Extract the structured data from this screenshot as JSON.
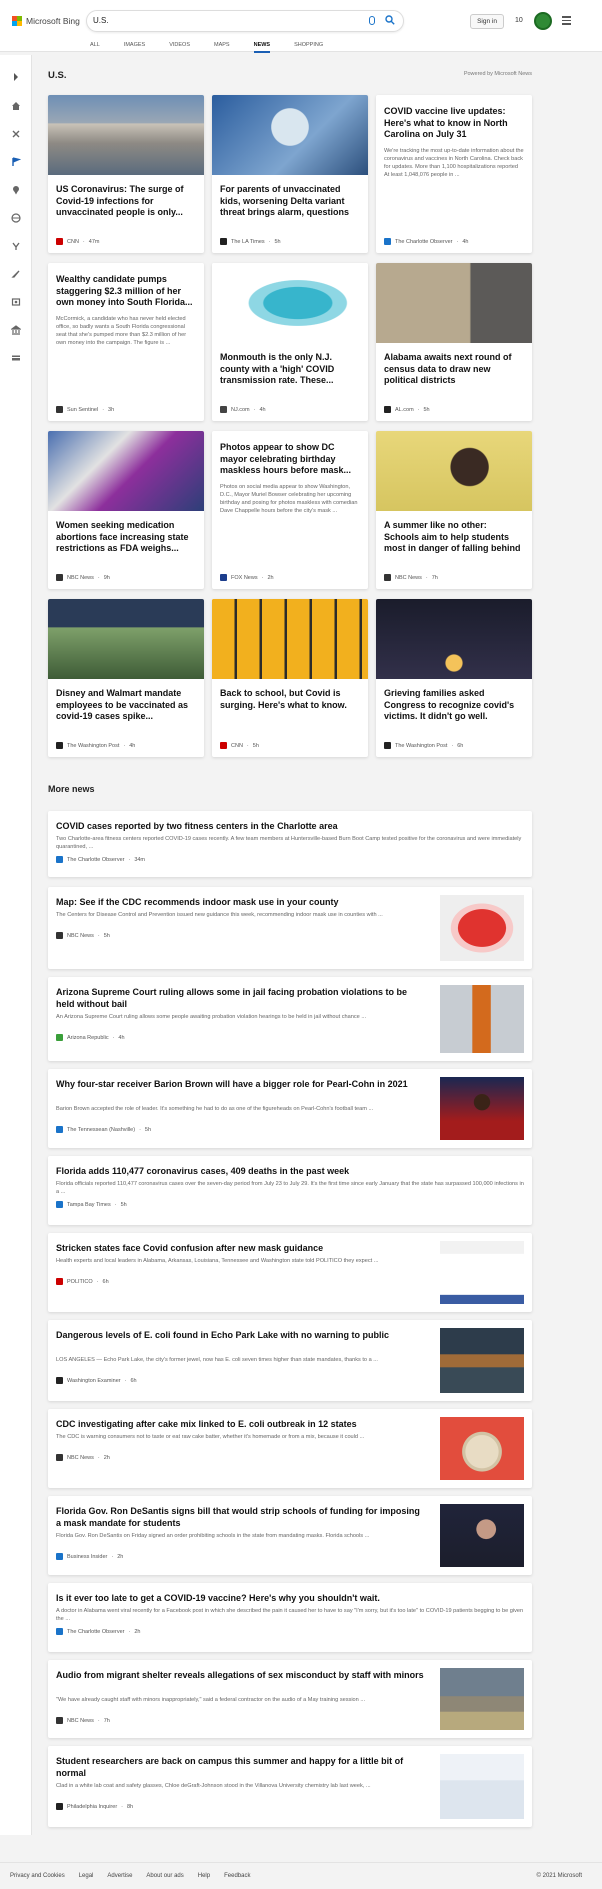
{
  "brand": {
    "name": "Microsoft Bing"
  },
  "search": {
    "query": "U.S."
  },
  "header": {
    "sign_in": "Sign in",
    "rewards_count": "10"
  },
  "tabs": [
    {
      "label": "ALL"
    },
    {
      "label": "IMAGES"
    },
    {
      "label": "VIDEOS"
    },
    {
      "label": "MAPS"
    },
    {
      "label": "NEWS",
      "active": true
    },
    {
      "label": "SHOPPING"
    }
  ],
  "rail_icons": [
    "chevron-right-icon",
    "home-icon",
    "science-icon",
    "flag-icon",
    "location-icon",
    "globe-icon",
    "scales-icon",
    "rocket-icon",
    "film-icon",
    "bank-icon",
    "card-icon"
  ],
  "section": {
    "title": "U.S.",
    "powered_by": "Powered by Microsoft News"
  },
  "cards": [
    {
      "title": "US Coronavirus: The surge of Covid-19 infections for unvaccinated people is only...",
      "source": "CNN",
      "time": "47m",
      "favicon_color": "#cc0000",
      "image": "tents"
    },
    {
      "title": "For parents of unvaccinated kids, worsening Delta variant threat brings alarm, questions",
      "source": "The LA Times",
      "time": "5h",
      "favicon_color": "#222222",
      "image": "vaccine"
    },
    {
      "title": "COVID vaccine live updates: Here's what to know in North Carolina on July 31",
      "snippet": "We're tracking the most up-to-date information about the coronavirus and vaccines in North Carolina. Check back for updates. More than 1,100 hospitalizations reported At least 1,048,076 people in ...",
      "source": "The Charlotte Observer",
      "time": "4h",
      "favicon_color": "#1a73c9",
      "image": ""
    },
    {
      "title": "Wealthy candidate pumps staggering $2.3 million of her own money into South Florida...",
      "snippet": "McCormick, a candidate who has never held elected office, so badly wants a South Florida congressional seat that she's pumped more than $2.3 million of her own money into the campaign. The figure is ...",
      "source": "Sun Sentinel",
      "time": "3h",
      "favicon_color": "#333333",
      "image": ""
    },
    {
      "title": "Monmouth is the only N.J. county with a 'high' COVID transmission rate. These...",
      "source": "NJ.com",
      "time": "4h",
      "favicon_color": "#444444",
      "image": "map"
    },
    {
      "title": "Alabama awaits next round of census data to draw new political districts",
      "source": "AL.com",
      "time": "5h",
      "favicon_color": "#222222",
      "image": "door"
    },
    {
      "title": "Women seeking medication abortions face increasing state restrictions as FDA weighs...",
      "source": "NBC News",
      "time": "9h",
      "favicon_color": "#333333",
      "image": "protest"
    },
    {
      "title": "Photos appear to show DC mayor celebrating birthday maskless hours before mask...",
      "snippet": "Photos on social media appear to show Washington, D.C., Mayor Muriel Bowser celebrating her upcoming birthday and posing for photos maskless with comedian Dave Chappelle hours before the city's mask ...",
      "source": "FOX News",
      "time": "2h",
      "favicon_color": "#1c3d8c",
      "image": ""
    },
    {
      "title": "A summer like no other: Schools aim to help students most in danger of falling behind",
      "source": "NBC News",
      "time": "7h",
      "favicon_color": "#333333",
      "image": "student"
    },
    {
      "title": "Disney and Walmart mandate employees to be vaccinated as covid-19 cases spike...",
      "source": "The Washington Post",
      "time": "4h",
      "favicon_color": "#222222",
      "image": "castle"
    },
    {
      "title": "Back to school, but Covid is surging. Here's what to know.",
      "source": "CNN",
      "time": "5h",
      "favicon_color": "#cc0000",
      "image": "buses"
    },
    {
      "title": "Grieving families asked Congress to recognize covid's victims. It didn't go well.",
      "source": "The Washington Post",
      "time": "6h",
      "favicon_color": "#222222",
      "image": "candles"
    }
  ],
  "more_news": {
    "title": "More news",
    "items": [
      {
        "title": "COVID cases reported by two fitness centers in the Charlotte area",
        "snippet": "Two Charlotte-area fitness centers reported COVID-19 cases recently. A few team members at Huntersville-based Burn Boot Camp tested positive for the coronavirus and were immediately quarantined, ...",
        "source": "The Charlotte Observer",
        "time": "34m",
        "favicon_color": "#1a73c9",
        "image": ""
      },
      {
        "title": "Map: See if the CDC recommends indoor mask use in your county",
        "snippet": "The Centers for Disease Control and Prevention issued new guidance this week, recommending indoor mask use in counties with ...",
        "source": "NBC News",
        "time": "5h",
        "favicon_color": "#333333",
        "image": "usmap"
      },
      {
        "title": "Arizona Supreme Court ruling allows some in jail facing probation violations to be held without bail",
        "snippet": "An Arizona Supreme Court ruling allows some people awaiting probation violation hearings to be held in jail without chance ...",
        "source": "Arizona Republic",
        "time": "4h",
        "favicon_color": "#3a9f3a",
        "image": "jail"
      },
      {
        "title": "Why four-star receiver Barion Brown will have a bigger role for Pearl-Cohn in 2021",
        "snippet": "Barion Brown accepted the role of leader. It's something he had to do as one of the figureheads on Pearl-Cohn's football team ...",
        "source": "The Tennessean (Nashville)",
        "time": "5h",
        "favicon_color": "#1a73c9",
        "image": "football"
      },
      {
        "title": "Florida adds 110,477 coronavirus cases, 409 deaths in the past week",
        "snippet": "Florida officials reported 110,477 coronavirus cases over the seven-day period from July 23 to July 29. It's the first time since early January that the state has surpassed 100,000 infections in a ...",
        "source": "Tampa Bay Times",
        "time": "5h",
        "favicon_color": "#1a73c9",
        "image": ""
      },
      {
        "title": "Stricken states face Covid confusion after new mask guidance",
        "snippet": "Health experts and local leaders in Alabama, Arkansas, Louisiana, Tennessee and Washington state told POLITICO they expect ...",
        "source": "POLITICO",
        "time": "6h",
        "favicon_color": "#cc0000",
        "image": "masksign"
      },
      {
        "title": "Dangerous levels of E. coli found in Echo Park Lake with no warning to public",
        "snippet": "LOS ANGELES — Echo Park Lake, the city's former jewel, now has E. coli seven times higher than state mandates, thanks to a ...",
        "source": "Washington Examiner",
        "time": "6h",
        "favicon_color": "#222222",
        "image": "lake"
      },
      {
        "title": "CDC investigating after cake mix linked to E. coli outbreak in 12 states",
        "snippet": "The CDC is warning consumers not to taste or eat raw cake batter, whether it's homemade or from a mix, because it could ...",
        "source": "NBC News",
        "time": "2h",
        "favicon_color": "#333333",
        "image": "cake"
      },
      {
        "title": "Florida Gov. Ron DeSantis signs bill that would strip schools of funding for imposing a mask mandate for students",
        "snippet": "Florida Gov. Ron DeSantis on Friday signed an order prohibiting schools in the state from mandating masks. Florida schools ...",
        "source": "Business Insider",
        "time": "2h",
        "favicon_color": "#1a73c9",
        "image": "governor"
      },
      {
        "title": "Is it ever too late to get a COVID-19 vaccine? Here's why you shouldn't wait.",
        "snippet": "A doctor in Alabama went viral recently for a Facebook post in which she described the pain it caused her to have to say \"I'm sorry, but it's too late\" to COVID-19 patients begging to be given the ...",
        "source": "The Charlotte Observer",
        "time": "2h",
        "favicon_color": "#1a73c9",
        "image": ""
      },
      {
        "title": "Audio from migrant shelter reveals allegations of sex misconduct by staff with minors",
        "snippet": "\"We have already caught staff with minors inappropriately,\" said a federal contractor on the audio of a May training session ...",
        "source": "NBC News",
        "time": "7h",
        "favicon_color": "#333333",
        "image": "shelter"
      },
      {
        "title": "Student researchers are back on campus this summer and happy for a little bit of normal",
        "snippet": "Clad in a white lab coat and safety glasses, Chloe deGraft-Johnson stood in the Villanova University chemistry lab last week, ...",
        "source": "Philadelphia Inquirer",
        "time": "8h",
        "favicon_color": "#222222",
        "image": "lab"
      }
    ]
  },
  "footer": {
    "links": [
      "Privacy and Cookies",
      "Legal",
      "Advertise",
      "About our ads",
      "Help",
      "Feedback"
    ],
    "copyright": "© 2021 Microsoft"
  }
}
